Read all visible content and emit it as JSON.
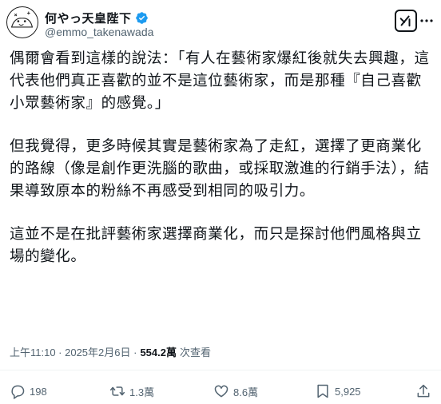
{
  "author": {
    "display_name": "何やっ天皇陛下",
    "handle": "@emmo_takenawada",
    "avatar_icon": "avatar-icon",
    "verified_icon": "verified-badge-icon",
    "verified_color": "#1d9bf0"
  },
  "post": {
    "paragraphs": [
      "偶爾會看到這樣的說法：「有人在藝術家爆紅後就失去興趣，這代表他們真正喜歡的並不是這位藝術家，而是那種『自己喜歡小眾藝術家』的感覺。」",
      "但我覺得，更多時候其實是藝術家為了走紅，選擇了更商業化的路線（像是創作更洗腦的歌曲，或採取激進的行銷手法），結果導致原本的粉絲不再感受到相同的吸引力。",
      "這並不是在批評藝術家選擇商業化，而只是探討他們風格與立場的變化。"
    ],
    "timestamp": "上午11:10 · 2025年2月6日 · ",
    "views_count": "554.2萬",
    "views_label": " 次查看"
  },
  "actions": {
    "replies": "198",
    "reposts": "1.3萬",
    "likes": "8.6萬",
    "bookmarks": "5,925"
  },
  "colors": {
    "text": "#0f1419",
    "secondary": "#536471",
    "divider": "#eff3f4"
  }
}
